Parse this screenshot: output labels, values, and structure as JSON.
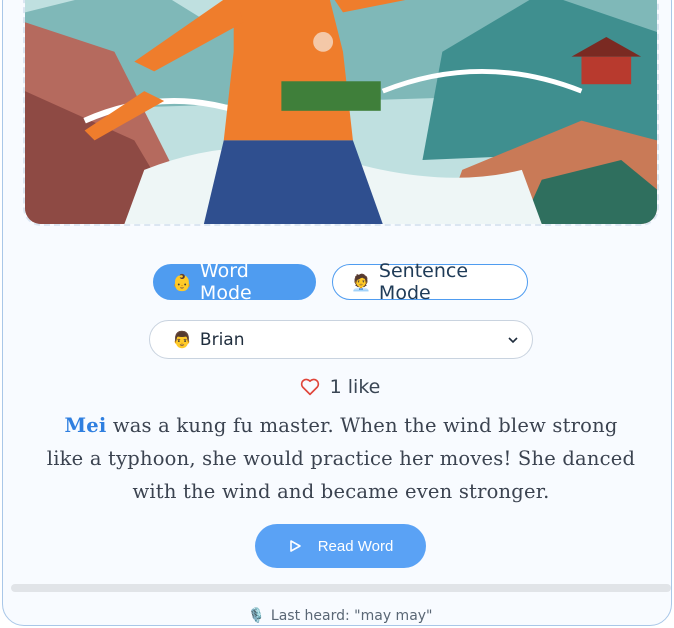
{
  "modes": {
    "word": {
      "emoji": "👶",
      "label": "Word Mode"
    },
    "sentence": {
      "emoji": "🧑‍💼",
      "label": "Sentence Mode"
    }
  },
  "voice_select": {
    "emoji": "👨",
    "selected": "Brian"
  },
  "likes": {
    "label": "1 like"
  },
  "story": {
    "highlighted_word": "Mei",
    "rest": " was a kung fu master. When the wind blew strong like a typhoon, she would practice her moves! She danced with the wind and became even stronger."
  },
  "read_button": {
    "label": "Read Word"
  },
  "progress": {
    "fraction": 0
  },
  "last_heard": {
    "label": "Last heard: \"may may\""
  },
  "colors": {
    "accent": "#4f9cf0",
    "highlight": "#2f7fe0",
    "heart": "#e0453a"
  }
}
